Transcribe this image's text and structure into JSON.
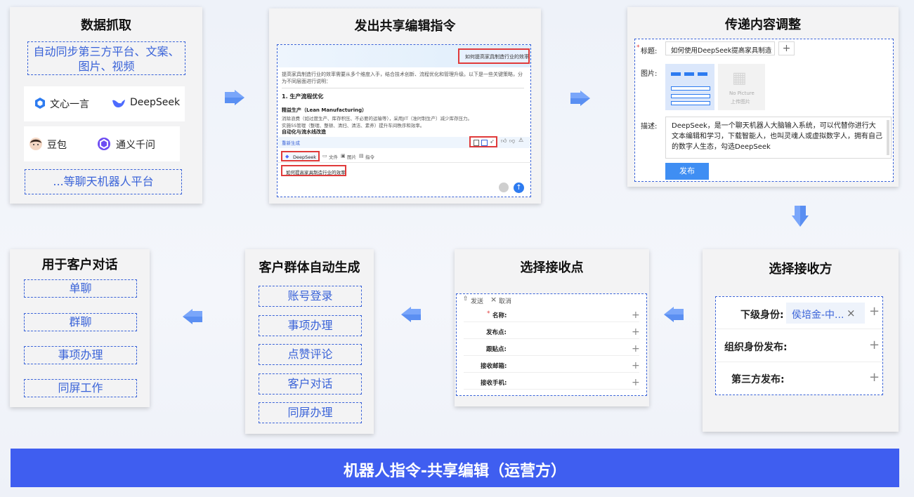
{
  "colors": {
    "accent": "#3a63d8",
    "banner": "#3f5ef0",
    "red": "#e03a3a",
    "arrow": "#3f7df0"
  },
  "banner": {
    "title": "机器人指令-共享编辑（运营方）"
  },
  "card1": {
    "title": "数据抓取",
    "sync_line1": "自动同步第三方平台、文案、",
    "sync_line2": "图片、视频",
    "bots": [
      {
        "name": "文心一言",
        "icon": "wenxin-icon"
      },
      {
        "name": "DeepSeek",
        "icon": "deepseek-icon"
      },
      {
        "name": "豆包",
        "icon": "doubao-icon"
      },
      {
        "name": "通义千问",
        "icon": "tongyi-icon"
      }
    ],
    "more": "...等聊天机器人平台"
  },
  "card2": {
    "title": "发出共享编辑指令",
    "query": "如何提高家具制造行业的效率",
    "intro": "提高家具制造行业的效率需要从多个维度入手，结合技术创新、流程优化和管理升级。以下是一些关键策略，分为不同层面进行说明：",
    "heading": "1. 生产流程优化",
    "sub1": "精益生产（Lean Manufacturing）",
    "line1": "消除浪费（如过度生产、库存积压、不必要的运输等），采用JIT（准时制生产）减少库存压力。",
    "line2": "实施5S管理（整理、整顿、清扫、清洁、素养）提升车间秩序和效率。",
    "sub2": "自动化与流水线改造",
    "regen": "重新生成",
    "tool_bot": "DeepSeek",
    "tool_file": "文件",
    "tool_image": "图片",
    "tool_cmd": "指令",
    "input_text": "如何提高家具制造行业的效率"
  },
  "card3": {
    "title": "传递内容调整",
    "label_title": "标题:",
    "title_value": "如何使用DeepSeek提高家具制造",
    "label_image": "图片:",
    "no_picture": "No Picture",
    "upload": "上传图片",
    "label_desc": "描述:",
    "desc": "DeepSeek，是一个聊天机器人大脑输入系统，可以代替你进行大文本编辑和学习，下载智能人，也叫灵魂人或虚拟数字人，拥有自己的数字人生态，勾选DeepSeek",
    "publish": "发布"
  },
  "card4": {
    "title": "选择接收方",
    "rows": [
      {
        "label": "下级身份:",
        "value": "侯培金-中..."
      },
      {
        "label": "组织身份发布:",
        "value": ""
      },
      {
        "label": "第三方发布:",
        "value": ""
      }
    ]
  },
  "card5": {
    "title": "选择接收点",
    "send": "发送",
    "cancel": "取消",
    "fields": [
      "名称:",
      "发布点:",
      "跟贴点:",
      "接收邮箱:",
      "接收手机:"
    ]
  },
  "card6": {
    "title": "客户群体自动生成",
    "items": [
      "账号登录",
      "事项办理",
      "点赞评论",
      "客户对话",
      "同屏办理"
    ]
  },
  "card7": {
    "title": "用于客户对话",
    "items": [
      "单聊",
      "群聊",
      "事项办理",
      "同屏工作"
    ]
  }
}
